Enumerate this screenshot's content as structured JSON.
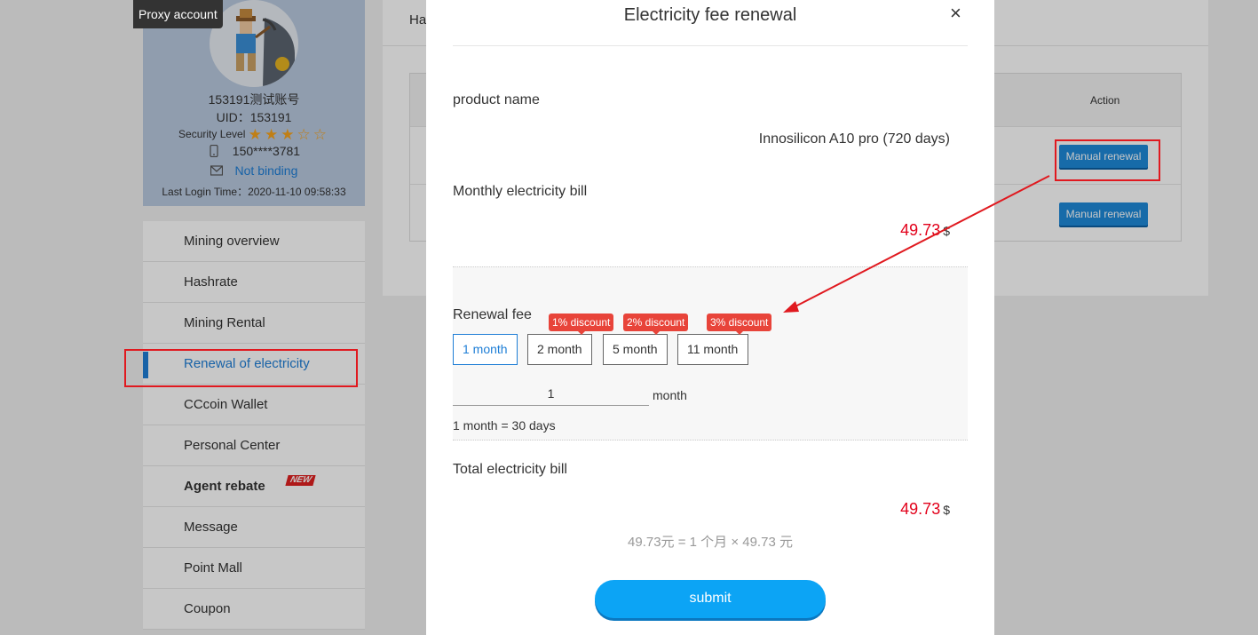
{
  "profile": {
    "proxy_badge": "Proxy account",
    "username": "153191测试账号",
    "uid": "UID：153191",
    "security_label": "Security Level",
    "security_stars": "★★★☆☆",
    "phone": "150****3781",
    "email_status": "Not binding",
    "last_login": "Last Login Time：2020-11-10 09:58:33"
  },
  "sidebar": {
    "items": [
      {
        "label": "Mining overview"
      },
      {
        "label": "Hashrate"
      },
      {
        "label": "Mining Rental"
      },
      {
        "label": "Renewal of electricity"
      },
      {
        "label": "CCcoin Wallet"
      },
      {
        "label": "Personal Center"
      },
      {
        "label": "Agent rebate"
      },
      {
        "label": "Message"
      },
      {
        "label": "Point Mall"
      },
      {
        "label": "Coupon"
      }
    ],
    "new_tag": "NEW"
  },
  "main": {
    "tab_text": "Ha",
    "action_header": "Action",
    "rows": [
      {
        "button": "Manual renewal"
      },
      {
        "button": "Manual renewal"
      }
    ]
  },
  "modal": {
    "title": "Electricity fee renewal",
    "close": "×",
    "product_label": "product name",
    "product_value": "Innosilicon A10 pro (720 days)",
    "monthly_label": "Monthly electricity bill",
    "monthly_value": "49.73",
    "currency": "$",
    "renewal_label": "Renewal fee",
    "options": [
      {
        "label": "1 month",
        "discount": ""
      },
      {
        "label": "2 month",
        "discount": "1% discount"
      },
      {
        "label": "5 month",
        "discount": "2% discount"
      },
      {
        "label": "11 month",
        "discount": "3% discount"
      }
    ],
    "month_input_value": "1",
    "month_unit": "month",
    "month_note": "1 month = 30 days",
    "total_label": "Total electricity bill",
    "total_value": "49.73",
    "formula": "49.73元 = 1 个月 × 49.73 元",
    "submit": "submit"
  },
  "colors": {
    "accent": "#1e7ed6",
    "price": "#e2001a",
    "discount": "#e8443a",
    "submit": "#0ca4f5",
    "annotation": "#e0191f"
  }
}
